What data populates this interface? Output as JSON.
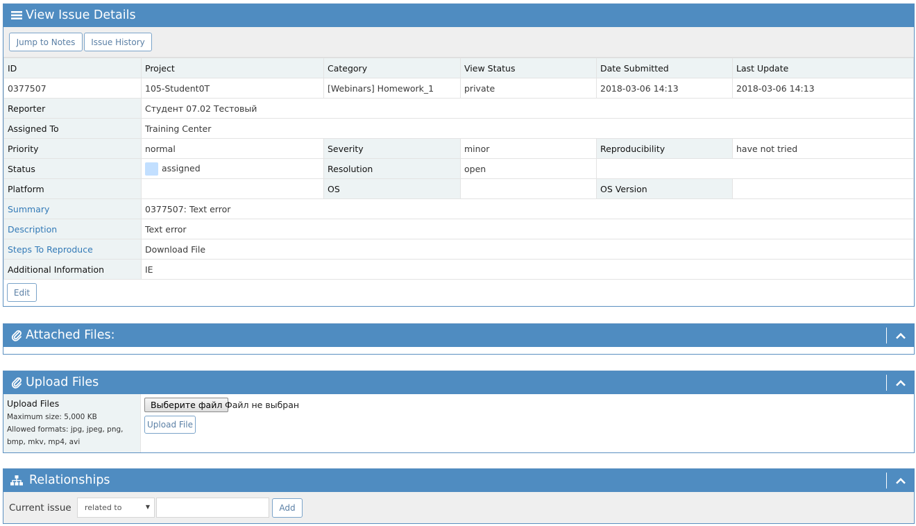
{
  "details": {
    "title": "View Issue Details",
    "icon": "bars-icon",
    "buttons": {
      "jump_to_notes": "Jump to Notes",
      "issue_history": "Issue History",
      "edit": "Edit"
    },
    "headers": [
      "ID",
      "Project",
      "Category",
      "View Status",
      "Date Submitted",
      "Last Update"
    ],
    "values": [
      "0377507",
      "105-Student0T",
      "[Webinars] Homework_1",
      "private",
      "2018-03-06 14:13",
      "2018-03-06 14:13"
    ],
    "reporter": {
      "label": "Reporter",
      "value": "Студент 07.02 Тестовый"
    },
    "assigned_to": {
      "label": "Assigned To",
      "value": "Training Center"
    },
    "priority": {
      "label": "Priority",
      "value": "normal"
    },
    "severity": {
      "label": "Severity",
      "value": "minor"
    },
    "reproducibility": {
      "label": "Reproducibility",
      "value": "have not tried"
    },
    "status": {
      "label": "Status",
      "value": "assigned",
      "color": "#c2dfff"
    },
    "resolution": {
      "label": "Resolution",
      "value": "open"
    },
    "platform": {
      "label": "Platform",
      "value": ""
    },
    "os": {
      "label": "OS",
      "value": ""
    },
    "os_version": {
      "label": "OS Version",
      "value": ""
    },
    "summary": {
      "label": "Summary",
      "value": "0377507: Text error"
    },
    "description": {
      "label": "Description",
      "value": "Text error"
    },
    "steps": {
      "label": "Steps To Reproduce",
      "value": "Download File"
    },
    "additional": {
      "label": "Additional Information",
      "value": "IE"
    }
  },
  "attached": {
    "title": "Attached Files:",
    "icon": "paperclip-icon"
  },
  "upload": {
    "title": "Upload Files",
    "icon": "paperclip-icon",
    "label": "Upload Files",
    "max_size": "Maximum size: 5,000 KB",
    "formats": "Allowed formats: jpg, jpeg, png, bmp, mkv, mp4, avi",
    "choose_button": "Выберите файл",
    "no_file": "Файл не выбран",
    "upload_button": "Upload File"
  },
  "relationships": {
    "title": "Relationships",
    "icon": "sitemap-icon",
    "current_issue": "Current issue",
    "select_value": "related to",
    "add_button": "Add"
  },
  "colors": {
    "header": "#4f8cc1",
    "category_bg": "#edf3f4",
    "link": "#337ab7"
  }
}
